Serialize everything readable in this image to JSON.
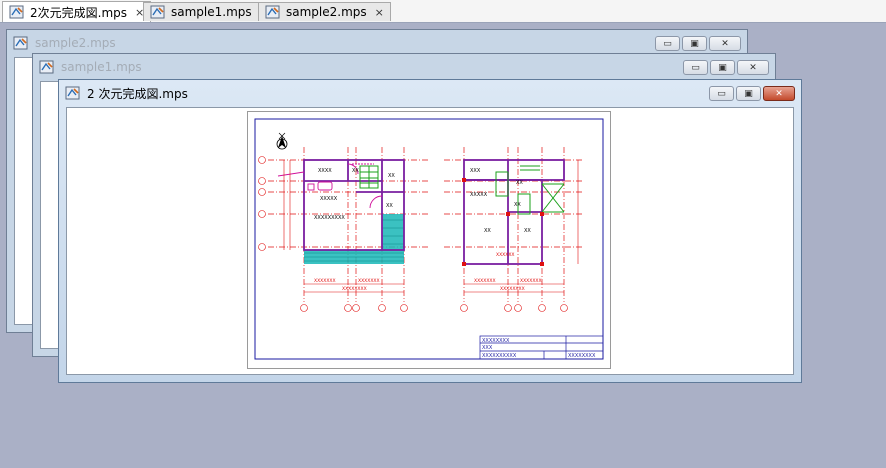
{
  "tabs": [
    {
      "label": "2次元完成図.mps",
      "close": "×",
      "active": true
    },
    {
      "label": "sample1.mps",
      "close": "×",
      "active": false
    },
    {
      "label": "sample2.mps",
      "close": "×",
      "active": false
    }
  ],
  "windows": {
    "sample2": {
      "title": "sample2.mps"
    },
    "sample1": {
      "title": "sample1.mps"
    },
    "main": {
      "title": "2 次元完成図.mps"
    }
  },
  "window_buttons": {
    "minimize": "▭",
    "restore": "▣",
    "close": "✕"
  },
  "drawing": {
    "title_block": {
      "row1": "XXXXXXXX",
      "row2": "XXX",
      "row3a": "XXXXXXXXXX",
      "row3b": "XXXXXXXX"
    },
    "room_label": "XX",
    "room_label_long": "XXXXXX",
    "dim_label": "XXXXXXX",
    "grid_mark": "X"
  },
  "colors": {
    "mdi_background": "#aab0c6",
    "active_close": "#c34a2c",
    "sheet_frame": "#1a1aa0",
    "grid_red": "#e01010",
    "wall_purple": "#7a1fa0",
    "stair_green": "#1aa01a",
    "hatch_cyan": "#19b7b7"
  }
}
